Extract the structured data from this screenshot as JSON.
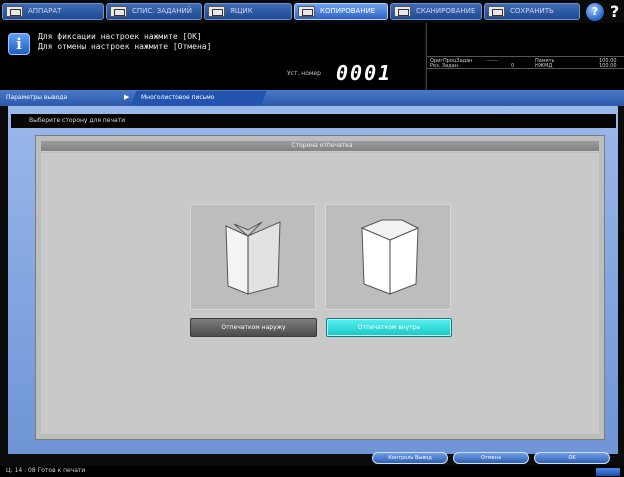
{
  "tabs": [
    {
      "label": "АППАРАТ",
      "active": false
    },
    {
      "label": "СПИС. ЗАДАНИЙ",
      "active": false
    },
    {
      "label": "ЯЩИК",
      "active": false
    },
    {
      "label": "КОПИРОВАНИЕ",
      "active": true
    },
    {
      "label": "СКАНИРОВАНИЕ",
      "active": false
    },
    {
      "label": "СОХРАНИТЬ",
      "active": false
    }
  ],
  "help_icon": "help-icon",
  "message": {
    "icon": "info-icon",
    "line1": "Для фиксации настроек нажмите [OK]",
    "line2": "Для отмены настроек нажмите [Отмена]"
  },
  "set_number": {
    "label": "Уст. номер",
    "value": "0001"
  },
  "status": {
    "orig_label": "ОригПроцЗадан",
    "orig_value": "------",
    "reserve_label": "Рез. Задан.",
    "reserve_value": "0",
    "memory_label": "Память",
    "memory_value": "100.00",
    "hdd_label": "НЖМД",
    "hdd_value": "100.00"
  },
  "breadcrumb": {
    "parent": "Параметры вывода",
    "current": "Многолистовое письмо"
  },
  "instruction": "Выберите сторону для печати",
  "panel_title": "Сторона отпечатка",
  "options": [
    {
      "label": "Отпечатком наружу",
      "icon": "fold-outside-icon",
      "selected": false
    },
    {
      "label": "Отпечатком внутрь",
      "icon": "fold-inside-icon",
      "selected": true
    }
  ],
  "buttons": {
    "check": "Контроль Вывод",
    "cancel": "Отмена",
    "ok": "OK"
  },
  "footer": "Ц: 14 : 08  Готов к печати"
}
